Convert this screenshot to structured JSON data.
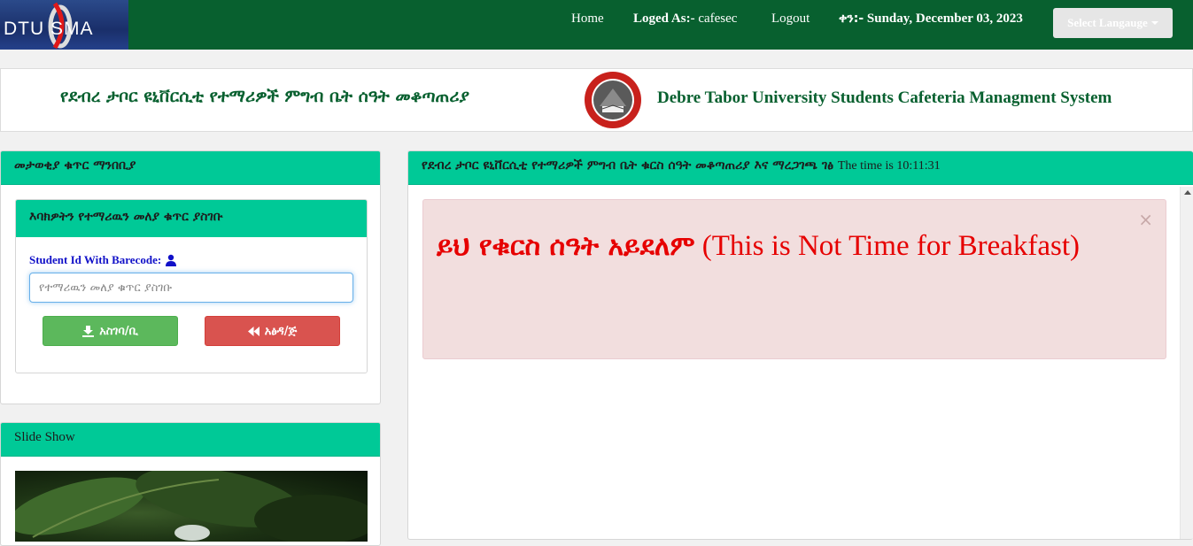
{
  "navbar": {
    "logo_text": "DTU  SMA",
    "home": "Home",
    "logged_as_label": "Loged As:-",
    "logged_as_user": "cafesec",
    "logout": "Logout",
    "date_label": "ቀን:-",
    "date_value": "Sunday, December 03, 2023",
    "language_button": "Select Langauge"
  },
  "banner": {
    "title_amharic": "የደብረ ታቦር ዩኒቨርሲቲ የተማሪዎች ምግብ ቤት ሰዓት መቆጣጠሪያ",
    "title_english": "Debre Tabor University Students Cafeteria Managment System"
  },
  "left_panel": {
    "heading": "መታወቂያ ቁጥር ማንበቢያ",
    "inner_heading": "እባክዎትን የተማሪዉን መለያ ቁጥር ያስገቡ",
    "student_id_label": "Student Id With Barecode:",
    "student_id_value": "",
    "student_id_placeholder": "የተማሪዉን መለያ ቁጥር ያስገቡ",
    "submit_label": "አስገባ/ቢ",
    "cancel_label": "አፅዳ/ጅ"
  },
  "slide_panel": {
    "heading": "Slide Show"
  },
  "right_panel": {
    "heading": "የደብረ ታቦር ዩኒቨርሲቲ የተማሪዎች ምግብ ቤት ቁርስ ሰዓት መቆጣጠሪያ እና ማረጋገጫ ገፅ",
    "time_prefix": "The time is",
    "time_value": "10:11:31",
    "alert_close": "×",
    "alert_amharic": "ይህ የቁርስ ሰዓት አይደለም",
    "alert_english": "(This is Not Time for Breakfast)"
  },
  "colors": {
    "navbar": "#08602f",
    "panel_header": "#00c997",
    "alert_bg": "#f2dede",
    "alert_text": "#e60000"
  }
}
